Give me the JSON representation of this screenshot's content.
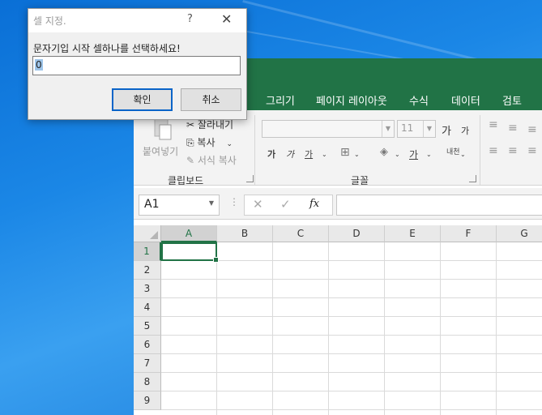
{
  "dialog": {
    "title": "셀 지정.",
    "help_label": "?",
    "close_label": "✕",
    "prompt": "문자기입 시작 셀하나를 선택하세요!",
    "input_value": "0",
    "ok_label": "확인",
    "cancel_label": "취소"
  },
  "excel": {
    "tabs": [
      "그리기",
      "페이지 레이아웃",
      "수식",
      "데이터",
      "검토"
    ],
    "clipboard": {
      "paste_label": "붙여넣기",
      "cut_label": "잘라내기",
      "copy_label": "복사",
      "format_painter_label": "서식 복사",
      "group_label": "클립보드"
    },
    "font": {
      "font_size": "11",
      "group_label": "글꼴",
      "grow_label": "가",
      "shrink_label": "가",
      "bold_label": "가",
      "italic_label": "가",
      "underline_label": "가",
      "font_color_label": "가",
      "phonetic_label": "내천"
    },
    "namebox_value": "A1",
    "fx_label": "fx",
    "columns": [
      "A",
      "B",
      "C",
      "D",
      "E",
      "F",
      "G"
    ],
    "rows": [
      "1",
      "2",
      "3",
      "4",
      "5",
      "6",
      "7",
      "8",
      "9"
    ],
    "accent_color": "#217346"
  }
}
